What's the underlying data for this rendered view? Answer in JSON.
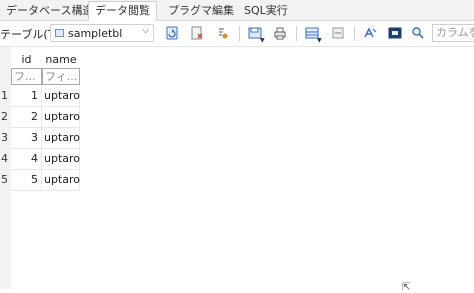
{
  "tabs": [
    {
      "label": "データベース構造",
      "active": false
    },
    {
      "label": "データ閲覧",
      "active": true
    },
    {
      "label": "プラグマ編集",
      "active": false
    },
    {
      "label": "SQL実行",
      "active": false
    }
  ],
  "toolbar": {
    "table_label": "テーブル(T):",
    "table_value": "sampletbl",
    "filter_placeholder": "カラムをフ",
    "icons": [
      "refresh-icon",
      "clear-filters-icon",
      "clear-sort-icon",
      "save-table-icon",
      "print-icon",
      "insert-record-icon",
      "delete-record-icon",
      "set-encoding-icon",
      "goto-icon",
      "find-icon"
    ]
  },
  "grid": {
    "columns": [
      "id",
      "name"
    ],
    "filter_placeholders": [
      "フ...",
      "フィ..."
    ],
    "rows": [
      {
        "num": "1",
        "id": "1",
        "name": "uptaro"
      },
      {
        "num": "2",
        "id": "2",
        "name": "uptaro"
      },
      {
        "num": "3",
        "id": "3",
        "name": "uptaro"
      },
      {
        "num": "4",
        "id": "4",
        "name": "uptaro"
      },
      {
        "num": "5",
        "id": "5",
        "name": "uptaro"
      }
    ]
  },
  "colors": {
    "accent_blue": "#3a6fc4",
    "grid_line": "#e8e8e8",
    "rownum_bg": "#f2f2f2"
  }
}
